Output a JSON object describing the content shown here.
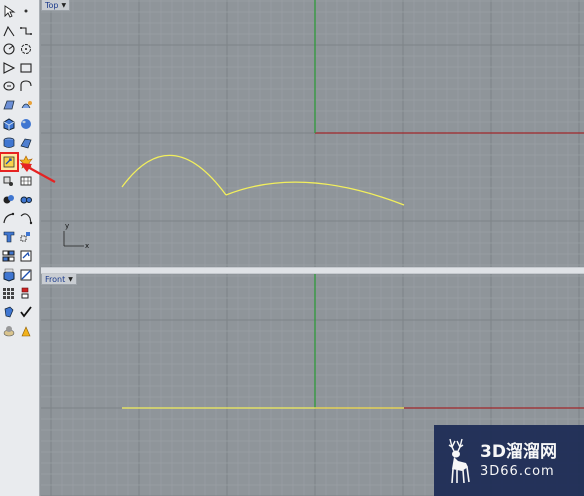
{
  "viewports": {
    "top": {
      "label": "Top",
      "axis_y": "y",
      "axis_x": "x"
    },
    "front": {
      "label": "Front"
    }
  },
  "watermark": {
    "brand": "3D溜溜网",
    "url": "3D66.com"
  },
  "colors": {
    "grid_bg": "#8f959a",
    "grid_line": "#9aa0a5",
    "grid_major": "#7d8388",
    "x_axis": "#a0282a",
    "y_axis": "#2e9a3a",
    "curve": "#f2ef5c",
    "highlight": "#e52222"
  },
  "toolbar": {
    "tools": [
      "select-arrow-icon",
      "point-icon",
      "polyline-icon",
      "line-segments-icon",
      "circle-icon",
      "arc-icon",
      "polygon-icon",
      "rectangle-icon",
      "ellipse-icon",
      "curve-icon",
      "surface-patch-icon",
      "loft-icon",
      "box-solid-icon",
      "sphere-icon",
      "cylinder-icon",
      "plane-surface-icon",
      "trim-icon",
      "explode-icon",
      "point-edit-icon",
      "mesh-icon",
      "boolean-icon",
      "fillet-icon",
      "offset-icon",
      "blend-curve-icon",
      "text-icon",
      "dimension-icon",
      "group-icon",
      "layer-icon",
      "render-icon",
      "analyze-icon",
      "array-icon",
      "mirror-icon",
      "transform-icon",
      "check-icon",
      "material-icon",
      "light-icon"
    ],
    "selected_index": 16
  }
}
